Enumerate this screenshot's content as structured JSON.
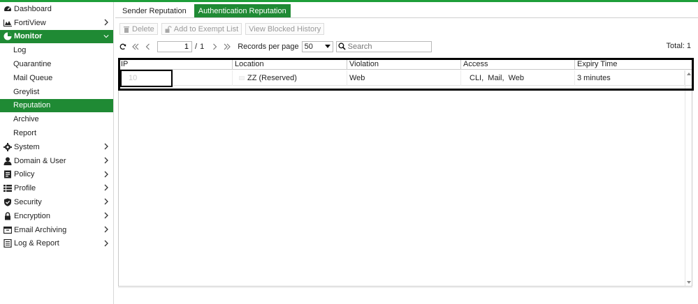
{
  "sidebar": {
    "items": [
      {
        "label": "Dashboard",
        "icon": "dashboard-icon",
        "chevron": false
      },
      {
        "label": "FortiView",
        "icon": "fortiview-icon",
        "chevron": true
      },
      {
        "label": "Monitor",
        "icon": "monitor-icon",
        "chevron": true
      },
      {
        "label": "Log"
      },
      {
        "label": "Quarantine"
      },
      {
        "label": "Mail Queue"
      },
      {
        "label": "Greylist"
      },
      {
        "label": "Reputation"
      },
      {
        "label": "Archive"
      },
      {
        "label": "Report"
      },
      {
        "label": "System",
        "icon": "gear-icon",
        "chevron": true
      },
      {
        "label": "Domain & User",
        "icon": "user-icon",
        "chevron": true
      },
      {
        "label": "Policy",
        "icon": "policy-icon",
        "chevron": true
      },
      {
        "label": "Profile",
        "icon": "profile-icon",
        "chevron": true
      },
      {
        "label": "Security",
        "icon": "shield-icon",
        "chevron": true
      },
      {
        "label": "Encryption",
        "icon": "lock-icon",
        "chevron": true
      },
      {
        "label": "Email Archiving",
        "icon": "archive-icon",
        "chevron": true
      },
      {
        "label": "Log & Report",
        "icon": "report-icon",
        "chevron": true
      }
    ]
  },
  "tabs": [
    {
      "label": "Sender Reputation",
      "active": false
    },
    {
      "label": "Authentication Reputation",
      "active": true
    }
  ],
  "toolbar": {
    "delete_label": "Delete",
    "exempt_label": "Add to Exempt List",
    "blocked_label": "View Blocked History"
  },
  "pager": {
    "current_page": "1",
    "separator": "/",
    "total_pages": "1",
    "records_label": "Records per page",
    "records_value": "50",
    "search_placeholder": "Search",
    "total_text": "Total: 1"
  },
  "table": {
    "columns": [
      "IP",
      "Location",
      "Violation",
      "Access",
      "Expiry Time"
    ],
    "rows": [
      {
        "ip": "10",
        "location": "ZZ (Reserved)",
        "violation": "Web",
        "access": "CLI,  Mail,  Web",
        "expiry": "3 minutes"
      }
    ]
  },
  "colors": {
    "accent": "#1f8a34",
    "topbar": "#1e9e3a"
  }
}
